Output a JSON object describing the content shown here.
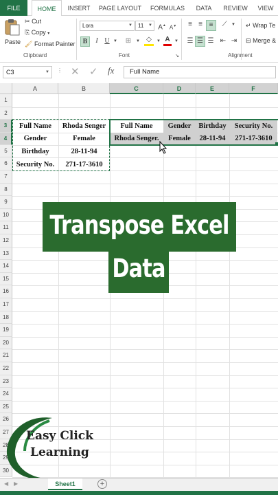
{
  "ribbon_tabs": [
    "FILE",
    "HOME",
    "INSERT",
    "PAGE LAYOUT",
    "FORMULAS",
    "DATA",
    "REVIEW",
    "VIEW"
  ],
  "clipboard": {
    "paste": "Paste",
    "cut": "Cut",
    "copy": "Copy",
    "format_painter": "Format Painter",
    "group": "Clipboard"
  },
  "font": {
    "name": "Lora",
    "size": "11",
    "group": "Font",
    "bold": "B",
    "italic": "I",
    "underline": "U"
  },
  "alignment": {
    "wrap_text": "Wrap Te",
    "merge": "Merge &",
    "group": "Alignment"
  },
  "formula_bar": {
    "name_box": "C3",
    "fx": "fx",
    "content": "Full Name"
  },
  "columns": [
    "A",
    "B",
    "C",
    "D",
    "E",
    "F"
  ],
  "rows": [
    "1",
    "2",
    "3",
    "4",
    "5",
    "6",
    "7",
    "8",
    "9",
    "10",
    "11",
    "12",
    "13",
    "14",
    "15",
    "16",
    "17",
    "18",
    "19",
    "20",
    "21",
    "22",
    "23",
    "24",
    "25",
    "26",
    "27",
    "28",
    "29",
    "30"
  ],
  "cells": {
    "A3": "Full Name",
    "B3": "Rhoda Senger",
    "A4": "Gender",
    "B4": "Female",
    "A5": "Birthday",
    "B5": "28-11-94",
    "A6": "Security No.",
    "B6": "271-17-3610",
    "C3": "Full Name",
    "D3": "Gender",
    "E3": "Birthday",
    "F3": "Security No.",
    "C4": "Rhoda Senger.",
    "D4": "Female",
    "E4": "28-11-94",
    "F4": "271-17-3610"
  },
  "overlay": {
    "line1": "Transpose Excel",
    "line2": "Data"
  },
  "logo": {
    "line1": "Easy Click",
    "line2": "Learning"
  },
  "sheet_tab": "Sheet1",
  "add_sheet": "+",
  "colors": {
    "excel_green": "#217346",
    "banner": "#2a6b2e"
  }
}
